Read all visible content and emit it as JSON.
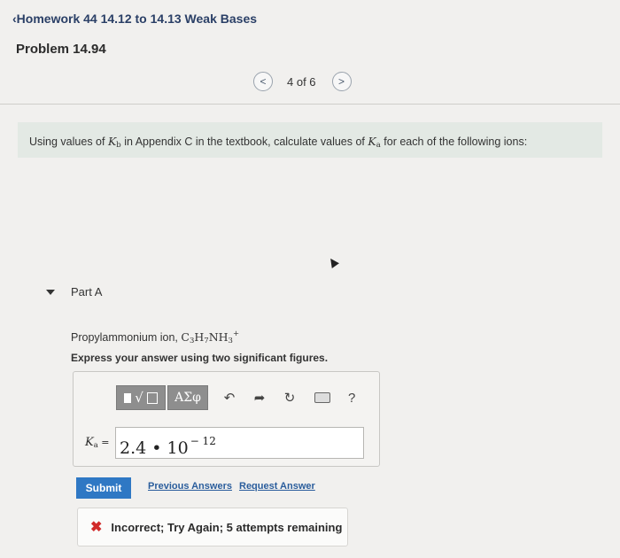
{
  "header": {
    "back_label": "Homework 44 14.12 to 14.13 Weak Bases",
    "problem_title": "Problem 14.94"
  },
  "pager": {
    "prev_glyph": "<",
    "next_glyph": ">",
    "count": "4 of 6"
  },
  "question": {
    "text_before": "Using values of ",
    "kb_symbol": "K",
    "kb_sub": "b",
    "text_middle": " in Appendix C in the textbook, calculate values of ",
    "ka_symbol": "K",
    "ka_sub": "a",
    "text_after": " for each of the following ions:"
  },
  "part": {
    "label": "Part A",
    "prompt_text": "Propylammonium ion, ",
    "formula": {
      "c": "C",
      "c_sub": "3",
      "h": "H",
      "h_sub": "7",
      "nh": "NH",
      "nh_sub": "3",
      "charge": "+"
    },
    "instruction": "Express your answer using two significant figures."
  },
  "toolbar": {
    "radical_glyph": "√",
    "greek_label": "ΑΣφ",
    "undo_glyph": "↶",
    "redo_glyph": "➦",
    "reset_glyph": "↻",
    "help_glyph": "?"
  },
  "answer": {
    "label_symbol": "K",
    "label_sub": "a",
    "label_eq": " =",
    "value_base": "2.4 • 10",
    "value_exp": "− 12"
  },
  "actions": {
    "submit_label": "Submit",
    "previous_answers": "Previous Answers",
    "request_answer": "Request Answer"
  },
  "feedback": {
    "icon": "✖",
    "message": "Incorrect; Try Again; 5 attempts remaining"
  }
}
